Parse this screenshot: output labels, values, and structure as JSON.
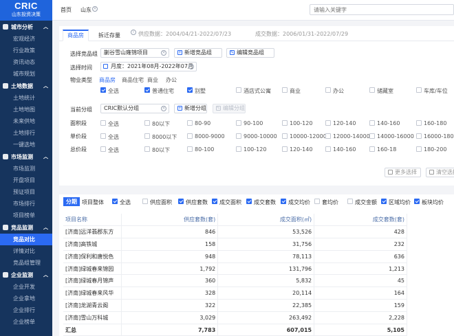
{
  "app": {
    "logo_title": "CRIC",
    "logo_subtitle": "山东投资决策"
  },
  "sidebar": [
    {
      "title": "城市分析",
      "items": [
        "宏观经济",
        "行业政策",
        "资讯动态",
        "城市规划"
      ]
    },
    {
      "title": "土地数据",
      "items": [
        "土地统计",
        "土地地图",
        "未来供地",
        "土地排行",
        "一键选地"
      ]
    },
    {
      "title": "市场监测",
      "items": [
        "市场监测",
        "开盘项目",
        "预证项目",
        "市场排行",
        "项目榜单"
      ]
    },
    {
      "title": "竞品监测",
      "items": [
        "竞品对比",
        "详情对比",
        "竞品组管理"
      ],
      "active_index": 0
    },
    {
      "title": "企业监测",
      "items": [
        "企业开发",
        "企业拿地",
        "企业排行",
        "企业榜单"
      ]
    }
  ],
  "topbar": {
    "home": "首页",
    "city": "山东",
    "search_placeholder": "请输入关键字"
  },
  "tabs": {
    "items": [
      "商品房",
      "拆迁存量"
    ],
    "active": 0,
    "supply_range": "供应数据：2004/04/21-2022/07/23",
    "deal_range": "成交数据：2006/01/31-2022/07/29"
  },
  "filters": {
    "group_label": "选择竞品组",
    "group_value": "蒯谷雪山雍锦项目",
    "new_group": "新增竞品组",
    "edit_group": "编辑竞品组",
    "time_label": "选择时间",
    "time_value": "月度：2021年08月-2022年07月",
    "property_label": "物业类型",
    "property_tabs": [
      "商品房",
      "商品住宅",
      "商业",
      "办公"
    ],
    "property_options": [
      {
        "label": "全选",
        "checked": true
      },
      {
        "label": "普通住宅",
        "checked": true
      },
      {
        "label": "别墅",
        "checked": true
      },
      {
        "label": "酒店式公寓",
        "checked": false
      },
      {
        "label": "商业",
        "checked": false
      },
      {
        "label": "办公",
        "checked": false
      },
      {
        "label": "储藏室",
        "checked": false
      },
      {
        "label": "车库/车位",
        "checked": false
      }
    ],
    "current_group_label": "当前分组",
    "current_group_value": "CRIC默认分组",
    "new_grouping": "新增分组",
    "edit_grouping": "编辑分组",
    "area_label": "面积段",
    "area_options": [
      "全选",
      "80以下",
      "80-90",
      "90-100",
      "100-120",
      "120-140",
      "140-160",
      "160-180"
    ],
    "unit_price_label": "单价段",
    "unit_price_options": [
      "全选",
      "8000以下",
      "8000-9000",
      "9000-10000",
      "10000-12000",
      "12000-14000",
      "14000-16000",
      "16000-18000"
    ],
    "total_price_label": "总价段",
    "total_price_options": [
      "全选",
      "80以下",
      "80-100",
      "100-120",
      "120-140",
      "140-160",
      "160-18",
      "180-200"
    ],
    "more": "更多选择",
    "clear": "清空选择"
  },
  "table_toolbar": {
    "tabs": [
      "分期",
      "项目整体"
    ],
    "metrics": [
      {
        "label": "全选",
        "checked": true
      },
      {
        "label": "供应面积",
        "checked": false
      },
      {
        "label": "供应套数",
        "checked": true
      },
      {
        "label": "成交面积",
        "checked": true
      },
      {
        "label": "成交套数",
        "checked": true
      },
      {
        "label": "成交均价",
        "checked": true
      },
      {
        "label": "套均价",
        "checked": false
      },
      {
        "label": "成交金额",
        "checked": false
      },
      {
        "label": "区域均价",
        "checked": true
      },
      {
        "label": "板块均价",
        "checked": true
      }
    ]
  },
  "table": {
    "columns": [
      "项目名称",
      "供应套数(套)",
      "成交面积(㎡)",
      "成交套数(套)"
    ],
    "rows": [
      [
        "[济南]远洋翡郡东方",
        "846",
        "53,526",
        "428"
      ],
      [
        "[济南]高铁城",
        "158",
        "31,756",
        "232"
      ],
      [
        "[济南]保利和唐悦色",
        "948",
        "78,113",
        "636"
      ],
      [
        "[济南]绿城春来锦园",
        "1,792",
        "131,796",
        "1,213"
      ],
      [
        "[济南]绿城春月锦声",
        "360",
        "5,832",
        "45"
      ],
      [
        "[济南]绿城春来风华",
        "328",
        "20,114",
        "164"
      ],
      [
        "[济南]龙湖青云阁",
        "322",
        "22,385",
        "159"
      ],
      [
        "[济南]雪山万科城",
        "3,029",
        "263,492",
        "2,228"
      ]
    ],
    "total": [
      "汇总",
      "7,783",
      "607,015",
      "5,105"
    ]
  },
  "colors": {
    "sidebar_bg": "#16345d",
    "accent": "#2b6af2",
    "logo_bg": "#1f64dc"
  }
}
